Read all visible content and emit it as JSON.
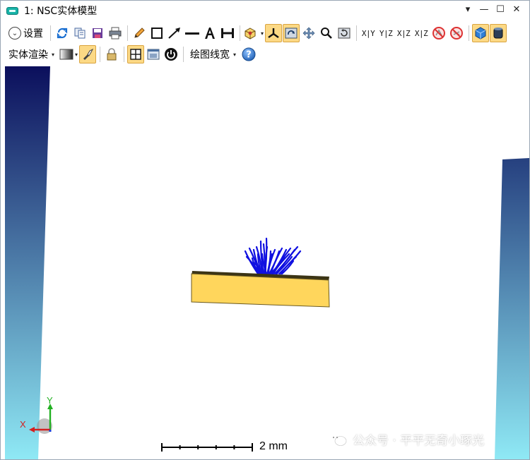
{
  "window": {
    "title": "1: NSC实体模型",
    "controls": [
      "▾",
      "—",
      "☐",
      "✕"
    ]
  },
  "toolbar1": {
    "settings_label": "设置",
    "axis_buttons": [
      "X|Y",
      "Y|Z",
      "X|Z",
      "X|Z"
    ]
  },
  "toolbar2": {
    "render_label": "实体渲染",
    "linewidth_label": "绘图线宽",
    "help_label": "?"
  },
  "viewport": {
    "scale_label": "2 mm",
    "axis_x": "X",
    "axis_y": "Y",
    "watermark": "公众号 · 平平无奇小琢光",
    "colors": {
      "gradient_top": "#0b0f5c",
      "gradient_bottom": "#8fe9f5",
      "slab_top": "#3b3415",
      "slab_face": "#ffd65c",
      "rays": "#1010e0",
      "axis_x_color": "#d42020",
      "axis_y_color": "#22b022"
    }
  }
}
